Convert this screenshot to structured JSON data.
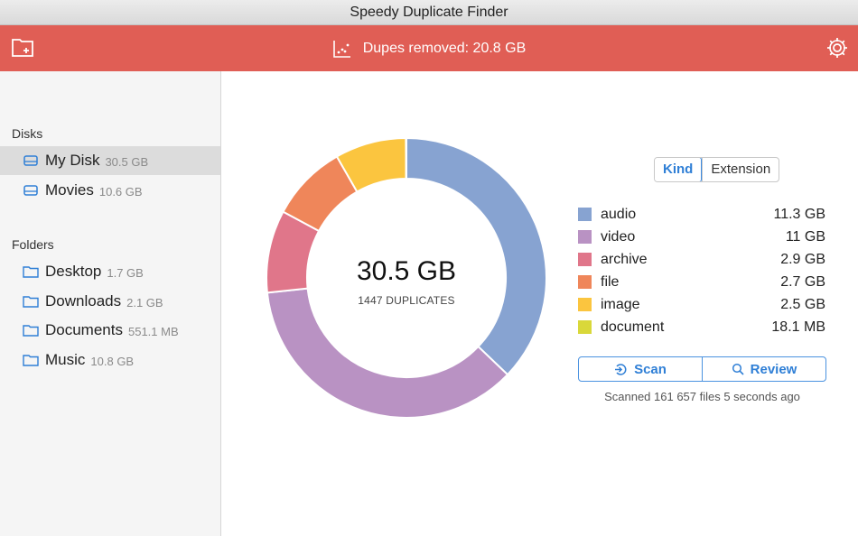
{
  "window": {
    "title": "Speedy Duplicate Finder"
  },
  "toolbar": {
    "stats": "Dupes removed: 20.8 GB",
    "add_folder_icon": "folder-plus-icon",
    "stats_icon": "chart-icon",
    "settings_icon": "gear-icon",
    "background": "#e05e55"
  },
  "sidebar": {
    "disks_title": "Disks",
    "disks": [
      {
        "name": "My Disk",
        "size": "30.5 GB",
        "selected": true
      },
      {
        "name": "Movies",
        "size": "10.6 GB",
        "selected": false
      }
    ],
    "folders_title": "Folders",
    "folders": [
      {
        "name": "Desktop",
        "size": "1.7 GB"
      },
      {
        "name": "Downloads",
        "size": "2.1 GB"
      },
      {
        "name": "Documents",
        "size": "551.1 MB"
      },
      {
        "name": "Music",
        "size": "10.8 GB"
      }
    ]
  },
  "summary": {
    "total": "30.5 GB",
    "count_label": "1447 DUPLICATES"
  },
  "segment": {
    "kind": "Kind",
    "extension": "Extension",
    "selected": "Kind"
  },
  "chart_data": {
    "type": "pie",
    "donut": true,
    "categories": [
      "audio",
      "video",
      "archive",
      "file",
      "image",
      "document"
    ],
    "values": [
      11.3,
      11,
      2.9,
      2.7,
      2.5,
      0.0181
    ],
    "value_labels": [
      "11.3 GB",
      "11 GB",
      "2.9 GB",
      "2.7 GB",
      "2.5 GB",
      "18.1 MB"
    ],
    "colors": [
      "#87a3d1",
      "#b992c3",
      "#e0768a",
      "#ef865a",
      "#fbc53f",
      "#d9d83a"
    ],
    "unit": "GB"
  },
  "actions": {
    "scan": "Scan",
    "review": "Review"
  },
  "status": "Scanned 161 657 files 5 seconds ago"
}
